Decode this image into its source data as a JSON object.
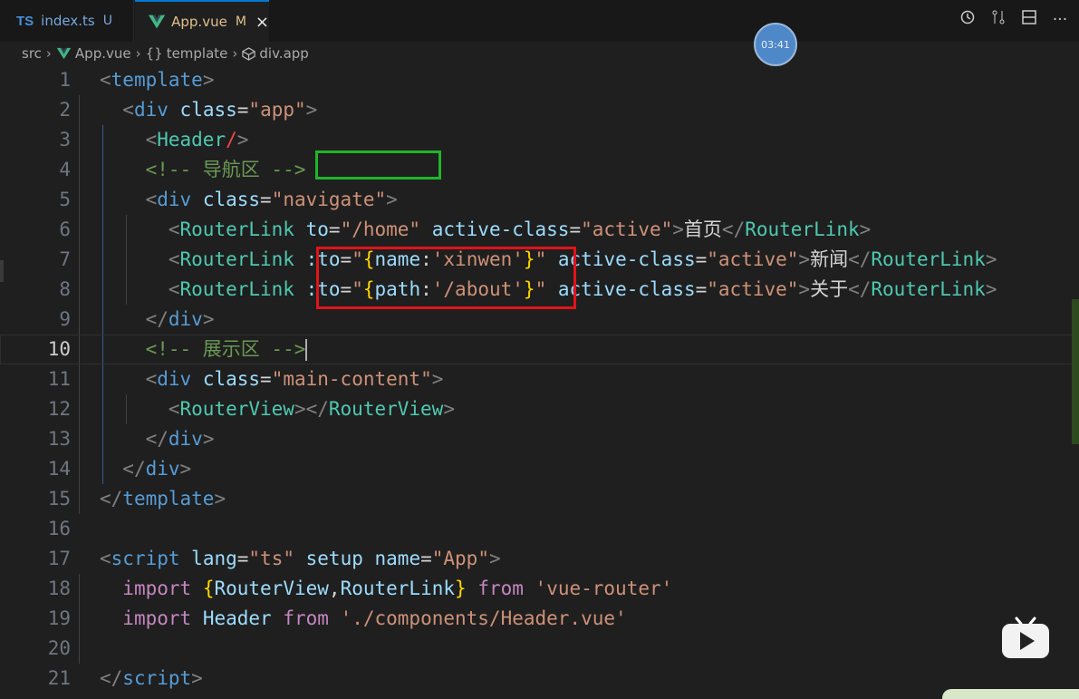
{
  "tabs": [
    {
      "icon": "TS",
      "name": "index.ts",
      "status": "U"
    },
    {
      "name": "App.vue",
      "status": "M",
      "close": "×"
    }
  ],
  "breadcrumb": [
    {
      "label": "src"
    },
    {
      "label": "App.vue",
      "icon": "vue-icon"
    },
    {
      "label": "template",
      "icon_text": "{}"
    },
    {
      "label": "div.app",
      "icon": "cube-icon"
    }
  ],
  "timer": "03:41",
  "current_line": 10,
  "code": {
    "l1": {
      "n": "1"
    },
    "l2": {
      "n": "2"
    },
    "l3": {
      "n": "3"
    },
    "l4": {
      "n": "4",
      "comment": "<!-- 导航区 -->"
    },
    "l5": {
      "n": "5"
    },
    "l6": {
      "n": "6",
      "text": "首页"
    },
    "l7": {
      "n": "7",
      "text": "新闻",
      "value": "xinwen"
    },
    "l8": {
      "n": "8",
      "text": "关于",
      "value": "/about"
    },
    "l9": {
      "n": "9"
    },
    "l10": {
      "n": "10",
      "comment": "<!-- 展示区 -->"
    },
    "l11": {
      "n": "11"
    },
    "l12": {
      "n": "12"
    },
    "l13": {
      "n": "13"
    },
    "l14": {
      "n": "14"
    },
    "l15": {
      "n": "15"
    },
    "l16": {
      "n": "16"
    },
    "l17": {
      "n": "17"
    },
    "l18": {
      "n": "18",
      "module": "'vue-router'"
    },
    "l19": {
      "n": "19",
      "module": "'./components/Header.vue'"
    },
    "l20": {
      "n": "20"
    },
    "l21": {
      "n": "21"
    }
  },
  "colors": {
    "highlight_green": "#1fb52b",
    "highlight_red": "#e0141a",
    "accent": "#0078d4"
  }
}
